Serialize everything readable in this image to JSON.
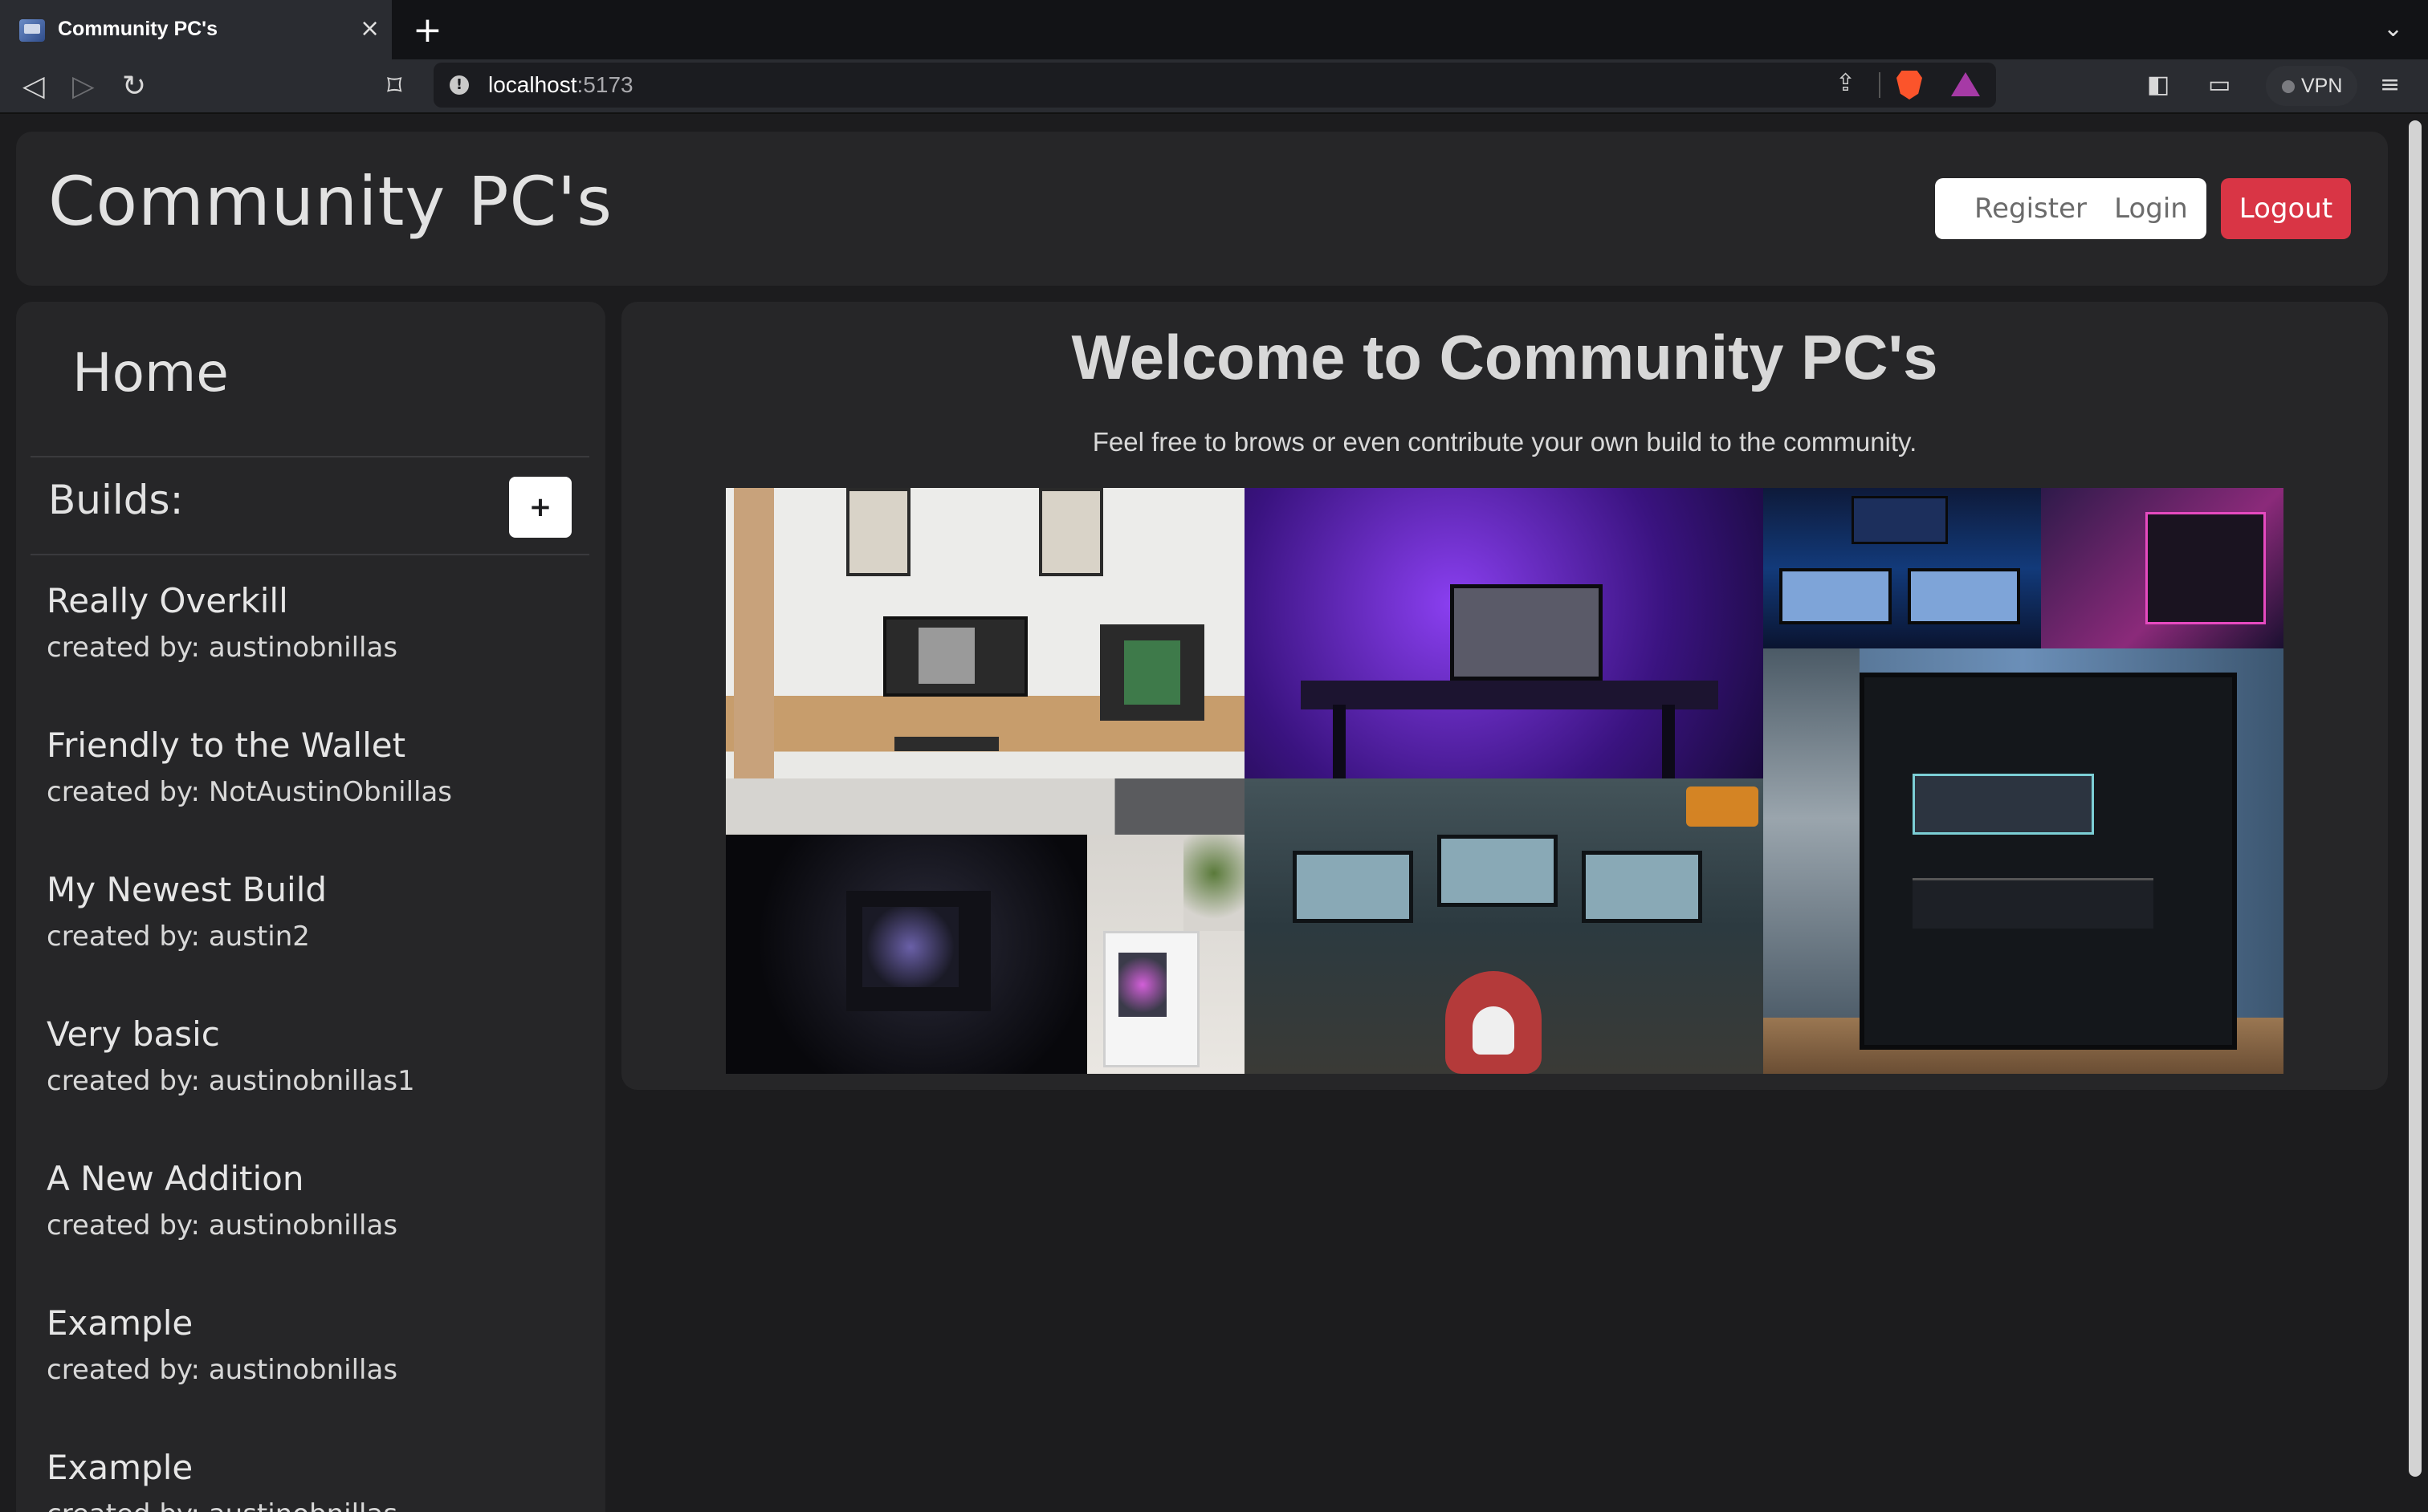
{
  "browser": {
    "tab_title": "Community PC's",
    "url_host": "localhost",
    "url_port": ":5173",
    "vpn_label": "VPN",
    "icons": {
      "close": "×",
      "new_tab": "+",
      "tab_list": "⌄",
      "back": "◁",
      "forward": "▷",
      "reload": "↻",
      "bookmark": "⌑",
      "share": "⇪",
      "sidebar": "◧",
      "wallet": "▭",
      "menu": "≡",
      "info": "!"
    }
  },
  "header": {
    "brand": "Community PC's",
    "register_label": "Register",
    "login_label": "Login",
    "logout_label": "Logout"
  },
  "sidebar": {
    "home_label": "Home",
    "builds_heading": "Builds:",
    "add_label": "+",
    "created_prefix": "created by: ",
    "builds": [
      {
        "title": "Really Overkill",
        "author": "austinobnillas"
      },
      {
        "title": "Friendly to the Wallet",
        "author": "NotAustinObnillas"
      },
      {
        "title": "My Newest Build",
        "author": "austin2"
      },
      {
        "title": "Very basic",
        "author": "austinobnillas1"
      },
      {
        "title": "A New Addition",
        "author": "austinobnillas"
      },
      {
        "title": "Example",
        "author": "austinobnillas"
      },
      {
        "title": "Example",
        "author": "austinobnillas"
      }
    ]
  },
  "main": {
    "heading": "Welcome to Community PC's",
    "subheading": "Feel free to brows or even contribute your own build to the community."
  },
  "colors": {
    "page_bg": "#1c1c1e",
    "panel_bg": "#262628",
    "logout_red": "#d93545"
  }
}
